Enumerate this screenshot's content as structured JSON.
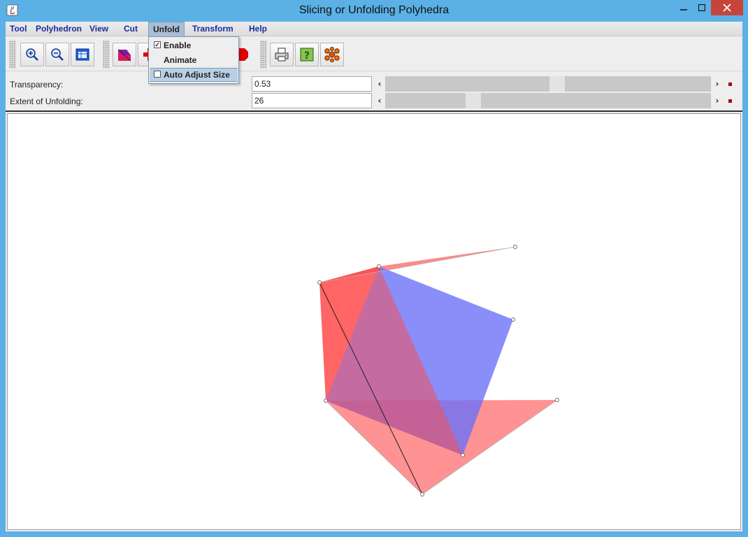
{
  "window": {
    "title": "Slicing or Unfolding Polyhedra"
  },
  "menubar": {
    "items": [
      "Tool",
      "Polyhedron",
      "View",
      "Cut",
      "Unfold",
      "Transform",
      "Help"
    ],
    "active": "Unfold"
  },
  "unfold_menu": {
    "items": [
      {
        "label": "Enable",
        "checked": true,
        "mnemonic": "E"
      },
      {
        "label": "Animate",
        "checked": false
      },
      {
        "label": "Auto Adjust Size",
        "checked": false,
        "highlighted": true
      }
    ]
  },
  "toolbar": {
    "buttons": [
      "zoom-in-icon",
      "zoom-out-icon",
      "fit-view-icon",
      "polyhedron-icon",
      "cut-icon",
      "stop-icon",
      "print-icon",
      "help-icon",
      "molecule-icon"
    ]
  },
  "controls": {
    "transparency": {
      "label": "Transparency:",
      "value": "0.53",
      "fraction": 0.53
    },
    "unfolding": {
      "label": "Extent of Unfolding:",
      "value": "26",
      "fraction": 0.26
    }
  },
  "colors": {
    "face_red": "#ff4a4a",
    "face_blue": "#6b72f8",
    "titlebar": "#5bb0e6",
    "menu_text": "#1a2c9c",
    "close_button": "#c7443a"
  }
}
